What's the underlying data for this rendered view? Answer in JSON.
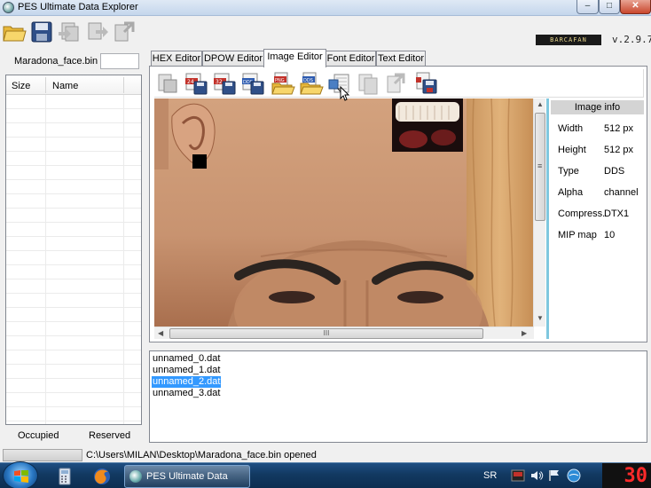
{
  "window": {
    "title": "PES Ultimate Data Explorer",
    "controls": {
      "minimize": "–",
      "maximize": "□",
      "close": "✕"
    }
  },
  "toolbar": {
    "buttons": [
      "open-folder-icon",
      "save-icon",
      "import-icon",
      "export-icon",
      "extract-icon"
    ],
    "logo_text": "BARCAFAN",
    "version": "v.2.9.7"
  },
  "left_panel": {
    "filename": "Maradona_face.bin",
    "columns": [
      "Size",
      "Name"
    ],
    "footer_occupied": "Occupied",
    "footer_reserved": "Reserved"
  },
  "tabs": [
    {
      "label": "HEX Editor",
      "active": false
    },
    {
      "label": "DPOW Editor",
      "active": false
    },
    {
      "label": "Image  Editor",
      "active": true
    },
    {
      "label": "Font Editor",
      "active": false
    },
    {
      "label": "Text Editor",
      "active": false
    }
  ],
  "image_tools": [
    "export-image-icon",
    "export-24bit-icon",
    "export-32bit-icon",
    "export-dds-icon",
    "import-png-icon",
    "import-dds-icon",
    "resize-icon",
    "copy-icon",
    "paste-icon",
    "save-image-icon"
  ],
  "image_info": {
    "header": "Image info",
    "rows": [
      {
        "label": "Width",
        "value": "512 px"
      },
      {
        "label": "Height",
        "value": "512 px"
      },
      {
        "label": "Type",
        "value": "DDS"
      },
      {
        "label": "Alpha",
        "value": "channel"
      },
      {
        "label": "Compress.",
        "value": "DTX1"
      },
      {
        "label": "MIP map",
        "value": "10"
      }
    ]
  },
  "scroll": {
    "h_grip": "III",
    "v_grip": "≡"
  },
  "file_list": {
    "items": [
      "unnamed_0.dat",
      "unnamed_1.dat",
      "unnamed_2.dat",
      "unnamed_3.dat"
    ],
    "selected_index": 2
  },
  "status": {
    "text": "C:\\Users\\MILAN\\Desktop\\Maradona_face.bin opened"
  },
  "taskbar": {
    "task_label": "PES Ultimate Data Ex...",
    "language": "SR",
    "clock_digits": "30"
  },
  "colors": {
    "accent": "#3399ff",
    "info_border": "#7fc7de",
    "skin": "#c99774"
  }
}
